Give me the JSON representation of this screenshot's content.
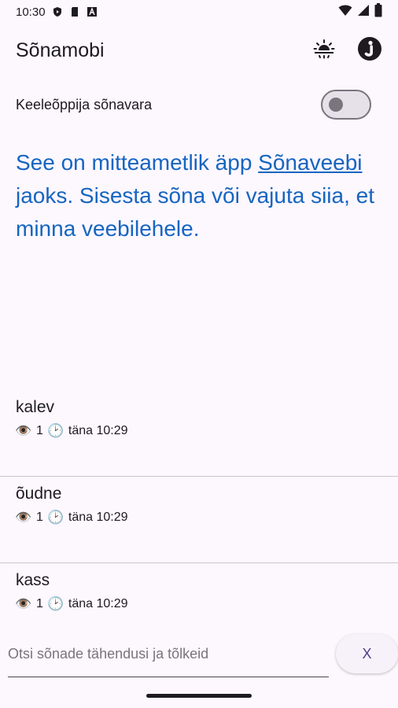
{
  "status_bar": {
    "time": "10:30",
    "left_icons": [
      "shield-play-icon",
      "sd-card-icon",
      "font-a-icon"
    ],
    "right_icons": [
      "wifi-icon",
      "signal-icon",
      "battery-icon"
    ]
  },
  "app_bar": {
    "title": "Sõnamobi",
    "actions": [
      "brightness-icon",
      "info-circle-icon"
    ]
  },
  "toggle": {
    "label": "Keeleõppija sõnavara",
    "on": false
  },
  "intro": {
    "part1": "See on mitteametlik äpp ",
    "link": "Sõnaveebi",
    "part2": " jaoks. Sisesta sõna või vajuta siia, et minna veebilehele."
  },
  "history": [
    {
      "word": "kalev",
      "views_icon": "👁️",
      "views": "1",
      "time_icon": "🕑",
      "time": "täna 10:29"
    },
    {
      "word": "õudne",
      "views_icon": "👁️",
      "views": "1",
      "time_icon": "🕑",
      "time": "täna 10:29"
    },
    {
      "word": "kass",
      "views_icon": "👁️",
      "views": "1",
      "time_icon": "🕑",
      "time": "täna 10:29"
    }
  ],
  "search": {
    "placeholder": "Otsi sõnade tähendusi ja tõlkeid",
    "value": "",
    "clear_label": "X"
  },
  "colors": {
    "background": "#fdf7fe",
    "link_blue": "#1565c0",
    "switch_outline": "#79747e"
  }
}
